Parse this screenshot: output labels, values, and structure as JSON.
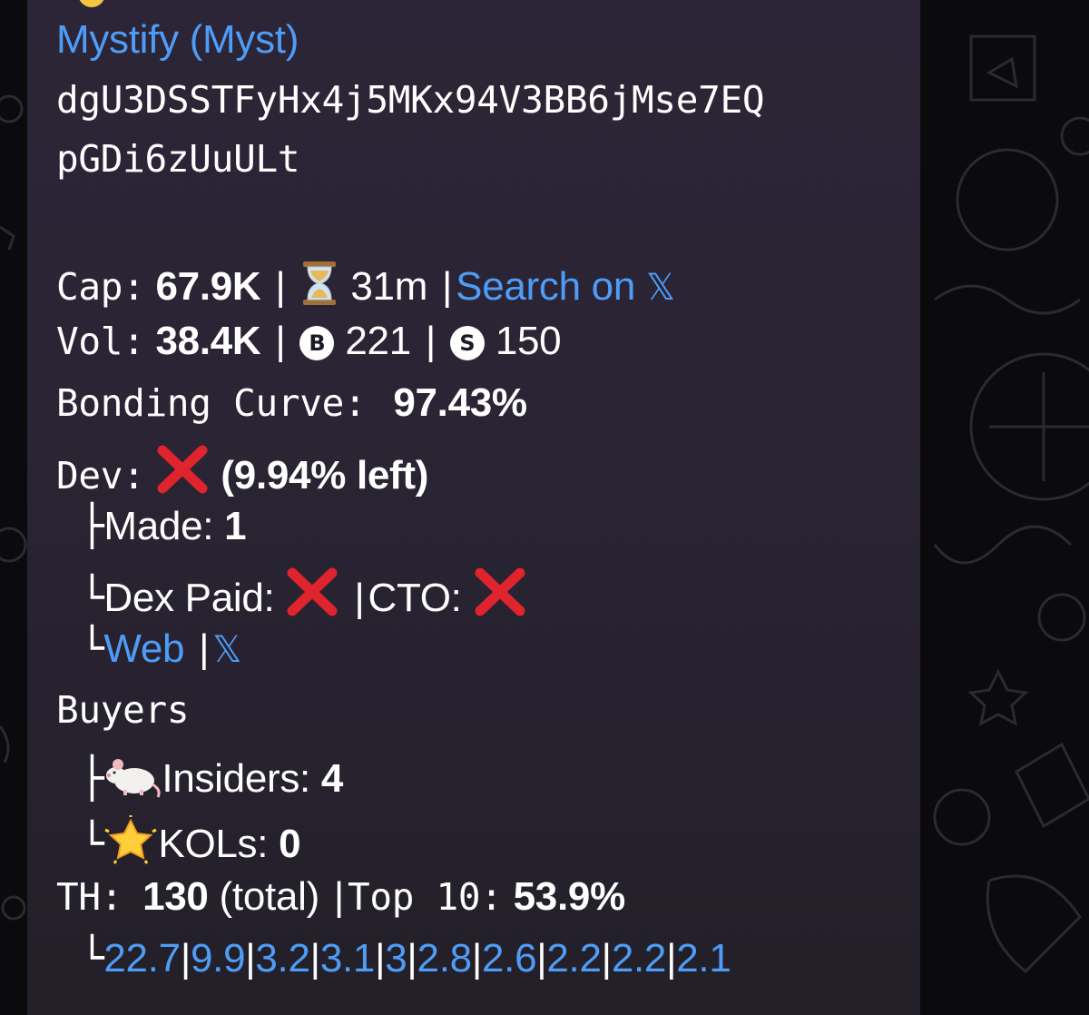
{
  "token": {
    "name": "Mystify (Myst)",
    "address_line1": "dgU3DSSTFyHx4j5MKx94V3BB6jMse7EQ",
    "address_line2": "pGDi6zUuULt"
  },
  "stats": {
    "cap_label": "Cap:",
    "cap_value": "67.9K",
    "age": "31m",
    "search_link": "Search on",
    "x_glyph": "𝕏",
    "vol_label": "Vol:",
    "vol_value": "38.4K",
    "buy_badge": "B",
    "buys": "221",
    "sell_badge": "S",
    "sells": "150",
    "bonding_label": "Bonding Curve:",
    "bonding_value": "97.43%"
  },
  "dev": {
    "label": "Dev:",
    "left": "(9.94% left)",
    "made_label": "Made:",
    "made_value": "1",
    "dex_paid_label": "Dex Paid:",
    "cto_label": "CTO:",
    "web_link": "Web",
    "x_link": "𝕏"
  },
  "buyers": {
    "title": "Buyers",
    "insiders_label": "Insiders:",
    "insiders_value": "4",
    "kols_label": "KOLs:",
    "kols_value": "0"
  },
  "holders": {
    "th_label": "TH:",
    "th_value": "130",
    "th_suffix": "(total)",
    "top10_label": "Top 10:",
    "top10_value": "53.9%",
    "top_percents": [
      "22.7",
      "9.9",
      "3.2",
      "3.1",
      "3",
      "2.8",
      "2.6",
      "2.2",
      "2.2",
      "2.1"
    ]
  },
  "colors": {
    "link": "#4f9cf6",
    "bubble": "#2a2434",
    "red_x": "#e0242d"
  },
  "icons": [
    "hourglass-icon",
    "red-x-icon",
    "rat-icon",
    "glowing-star-icon",
    "x-logo-icon"
  ]
}
